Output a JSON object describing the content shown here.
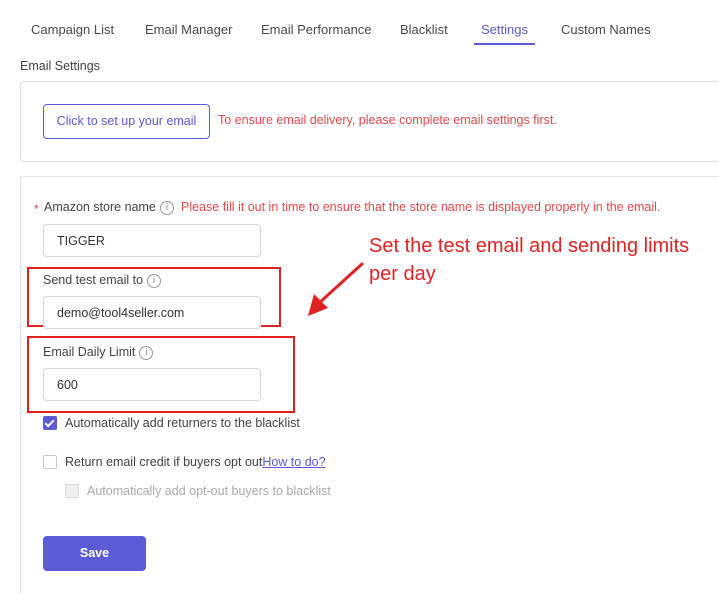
{
  "tabs": [
    {
      "label": "Campaign List"
    },
    {
      "label": "Email Manager"
    },
    {
      "label": "Email Performance"
    },
    {
      "label": "Blacklist"
    },
    {
      "label": "Settings",
      "active": true
    },
    {
      "label": "Custom Names"
    }
  ],
  "email_settings": {
    "section_label": "Email Settings",
    "setup_button": "Click to set up your email",
    "setup_warning": "To ensure email delivery, please complete email settings first."
  },
  "form": {
    "required_marker": "*",
    "store_name": {
      "label": "Amazon store name",
      "hint": "Please fill it out in time to ensure that the store name is displayed properly in the email.",
      "value": "TIGGER"
    },
    "test_email": {
      "label": "Send test email to",
      "value": "demo@tool4seller.com"
    },
    "daily_limit": {
      "label": "Email Daily Limit",
      "value": "600"
    },
    "auto_blacklist_returners": {
      "label": "Automatically add returners to the blacklist",
      "checked": true
    },
    "return_credit": {
      "label": "Return email credit if buyers opt out",
      "link": "How to do?",
      "checked": false
    },
    "auto_blacklist_optout": {
      "label": "Automatically add opt-out buyers to blacklist",
      "checked": false,
      "disabled": true
    },
    "save_button": "Save"
  },
  "annotation": {
    "text": "Set the test email and sending limits per day"
  },
  "icons": {
    "info": "info-icon",
    "check": "check-icon"
  },
  "colors": {
    "accent": "#5b5bd6",
    "warning_text": "#e04b4b",
    "annotation": "#e02424"
  }
}
